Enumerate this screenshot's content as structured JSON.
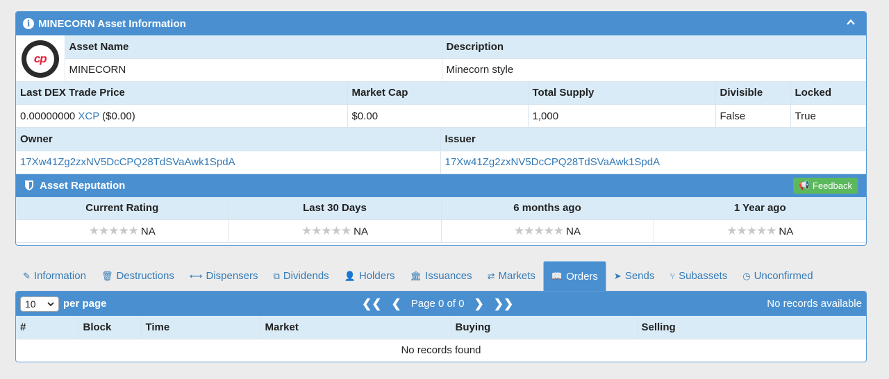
{
  "asset_panel": {
    "title": "MINECORN Asset Information",
    "info_icon": "info-circle-icon",
    "collapse_icon": "chevron-up-icon",
    "logo_text": "cp",
    "asset_name_label": "Asset Name",
    "asset_name": "MINECORN",
    "description_label": "Description",
    "description": "Minecorn style",
    "price_label": "Last DEX Trade Price",
    "price_value": "0.00000000",
    "price_unit": "XCP",
    "price_usd": "($0.00)",
    "market_cap_label": "Market Cap",
    "market_cap": "$0.00",
    "supply_label": "Total Supply",
    "supply": "1,000",
    "divisible_label": "Divisible",
    "divisible": "False",
    "locked_label": "Locked",
    "locked": "True",
    "owner_label": "Owner",
    "owner": "17Xw41Zg2zxNV5DcCPQ28TdSVaAwk1SpdA",
    "issuer_label": "Issuer",
    "issuer": "17Xw41Zg2zxNV5DcCPQ28TdSVaAwk1SpdA"
  },
  "reputation": {
    "title": "Asset Reputation",
    "feedback_label": "Feedback",
    "columns": [
      {
        "header": "Current Rating",
        "value": "NA"
      },
      {
        "header": "Last 30 Days",
        "value": "NA"
      },
      {
        "header": "6 months ago",
        "value": "NA"
      },
      {
        "header": "1 Year ago",
        "value": "NA"
      }
    ]
  },
  "tabs": [
    {
      "label": "Information",
      "icon": "✎"
    },
    {
      "label": "Destructions",
      "icon": "🗑"
    },
    {
      "label": "Dispensers",
      "icon": "⟷"
    },
    {
      "label": "Dividends",
      "icon": "⧉"
    },
    {
      "label": "Holders",
      "icon": "👤"
    },
    {
      "label": "Issuances",
      "icon": "🏛"
    },
    {
      "label": "Markets",
      "icon": "⇄"
    },
    {
      "label": "Orders",
      "icon": "📖"
    },
    {
      "label": "Sends",
      "icon": "➤"
    },
    {
      "label": "Subassets",
      "icon": "⑂"
    },
    {
      "label": "Unconfirmed",
      "icon": "◷"
    }
  ],
  "orders": {
    "per_page_value": "10",
    "per_page_label": "per page",
    "page_text": "Page 0 of 0",
    "records_text": "No records available",
    "columns": [
      "#",
      "Block",
      "Time",
      "Market",
      "Buying",
      "Selling"
    ],
    "empty_text": "No records found"
  },
  "colors": {
    "accent": "#4a90d0",
    "header_row": "#d9ebf7",
    "feedback": "#5cb85c",
    "link": "#337ab7"
  }
}
